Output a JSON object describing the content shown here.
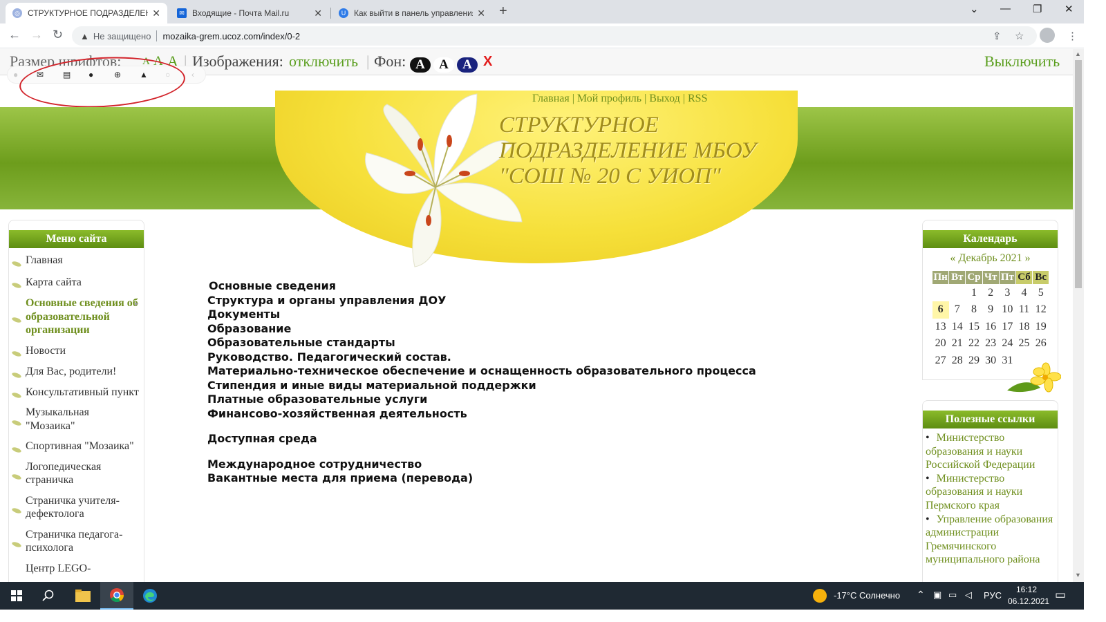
{
  "browser": {
    "tabs": [
      {
        "title": "СТРУКТУРНОЕ ПОДРАЗДЕЛЕНИЕ",
        "active": true
      },
      {
        "title": "Входящие - Почта Mail.ru",
        "active": false
      },
      {
        "title": "Как выйти в панель управления",
        "active": false
      }
    ],
    "security_label": "Не защищено",
    "url": "mozaika-grem.ucoz.com/index/0-2"
  },
  "accessibility": {
    "font_size_label": "Размер шрифтов:",
    "font_sizes": [
      "A",
      "A",
      "A"
    ],
    "images_label": "Изображения:",
    "images_toggle": "отключить",
    "background_label": "Фон:",
    "background_buttons": [
      "A",
      "A",
      "A"
    ],
    "close": "X",
    "disable": "Выключить"
  },
  "header": {
    "links": [
      "Главная",
      "Мой профиль",
      "Выход",
      "RSS"
    ],
    "title_lines": [
      "СТРУКТУРНОЕ",
      "ПОДРАЗДЕЛЕНИЕ МБОУ",
      "\"СОШ № 20 С УИОП\""
    ]
  },
  "menu": {
    "title": "Меню сайта",
    "items": [
      "Главная",
      "Карта сайта",
      "Основные сведения об образовательной организации",
      "Новости",
      "Для Вас, родители!",
      "Консультативный пункт",
      "Музыкальная \"Мозаика\"",
      "Спортивная \"Мозаика\"",
      "Логопедическая страничка",
      "Страничка учителя-дефектолога",
      "Страничка педагога-психолога",
      "Центр LEGO-"
    ]
  },
  "content": {
    "group1": [
      "Основные сведения",
      "Структура и органы управления ДОУ",
      "Документы",
      "Образование",
      "Образовательные стандарты",
      "Руководство. Педагогический состав.",
      "Материально-техническое обеспечение и оснащенность образовательного процесса",
      "Стипендия и иные виды материальной поддержки",
      "Платные образовательные услуги",
      "Финансово-хозяйственная деятельность"
    ],
    "group2": [
      "Доступная среда"
    ],
    "group3": [
      "Международное сотрудничество",
      "Вакантные места для приема (перевода)"
    ]
  },
  "calendar": {
    "title": "Календарь",
    "prev": "«",
    "month": "Декабрь 2021",
    "next": "»",
    "weekdays": [
      "Пн",
      "Вт",
      "Ср",
      "Чт",
      "Пт",
      "Сб",
      "Вс"
    ],
    "weeks": [
      [
        "",
        "",
        "1",
        "2",
        "3",
        "4",
        "5"
      ],
      [
        "6",
        "7",
        "8",
        "9",
        "10",
        "11",
        "12"
      ],
      [
        "13",
        "14",
        "15",
        "16",
        "17",
        "18",
        "19"
      ],
      [
        "20",
        "21",
        "22",
        "23",
        "24",
        "25",
        "26"
      ],
      [
        "27",
        "28",
        "29",
        "30",
        "31",
        "",
        ""
      ]
    ],
    "today": "6"
  },
  "useful_links": {
    "title": "Полезные ссылки",
    "items": [
      "Министерство образования и науки Российской Федерации",
      "Министерство образования и науки Пермского края",
      "Управление образования администрации Гремячинского муниципального района"
    ]
  },
  "taskbar": {
    "weather": "-17°C Солнечно",
    "lang": "РУС",
    "time": "16:12",
    "date": "06.12.2021"
  },
  "colors": {
    "accent": "#6f8f1e",
    "header_green": "#6d9d1c",
    "annotation_red": "#d2232a"
  }
}
